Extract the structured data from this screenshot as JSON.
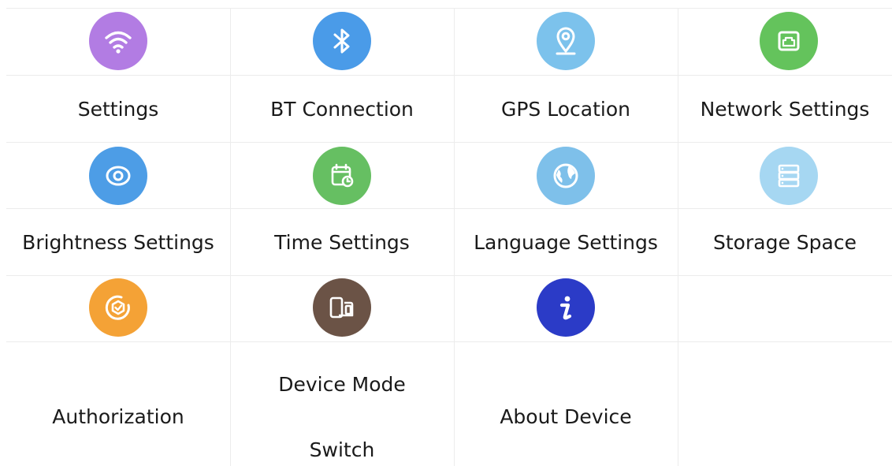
{
  "items": [
    {
      "label": "Settings",
      "icon": "wifi-icon",
      "color": "#b27ce3"
    },
    {
      "label": "BT Connection",
      "icon": "bluetooth-icon",
      "color": "#4a9be8"
    },
    {
      "label": "GPS Location",
      "icon": "location-pin-icon",
      "color": "#7cc2ec"
    },
    {
      "label": "Network Settings",
      "icon": "ethernet-port-icon",
      "color": "#64c35c"
    },
    {
      "label": "Brightness Settings",
      "icon": "eye-icon",
      "color": "#4d9de6"
    },
    {
      "label": "Time Settings",
      "icon": "calendar-clock-icon",
      "color": "#66bf62"
    },
    {
      "label": "Language Settings",
      "icon": "globe-icon",
      "color": "#7ec0ea"
    },
    {
      "label": "Storage Space",
      "icon": "server-stack-icon",
      "color": "#a6d7f2"
    },
    {
      "label": "Authorization",
      "icon": "authorization-shield-icon",
      "color": "#f4a236"
    },
    {
      "label_line1": "Device Mode",
      "label_line2": "Switch",
      "icon": "device-switch-icon",
      "color": "#6b5346"
    },
    {
      "label": "About Device",
      "icon": "info-icon",
      "color": "#2b3bc7"
    }
  ]
}
